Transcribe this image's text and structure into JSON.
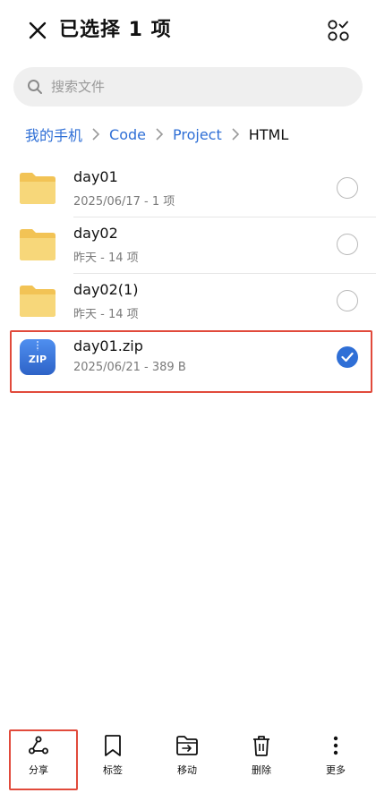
{
  "header": {
    "title": "已选择 1 项"
  },
  "search": {
    "placeholder": "搜索文件"
  },
  "breadcrumb": {
    "items": [
      "我的手机",
      "Code",
      "Project",
      "HTML"
    ]
  },
  "files": [
    {
      "name": "day01",
      "meta": "2025/06/17 - 1 项",
      "type": "folder",
      "selected": false
    },
    {
      "name": "day02",
      "meta": "昨天 - 14 项",
      "type": "folder",
      "selected": false
    },
    {
      "name": "day02(1)",
      "meta": "昨天 - 14 项",
      "type": "folder",
      "selected": false
    },
    {
      "name": "day01.zip",
      "meta": "2025/06/21 - 389 B",
      "type": "zip",
      "icon_text": "ZIP",
      "selected": true
    }
  ],
  "toolbar": {
    "share": "分享",
    "tag": "标签",
    "move": "移动",
    "delete": "删除",
    "more": "更多"
  },
  "colors": {
    "accent": "#2f6fd6",
    "folder": "#f4c95d",
    "highlight": "#e14a3b"
  }
}
